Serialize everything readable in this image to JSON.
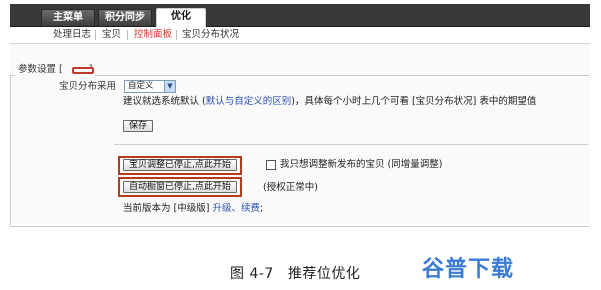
{
  "tabs": [
    {
      "label": "主菜单"
    },
    {
      "label": "积分同步"
    },
    {
      "label": "优化"
    }
  ],
  "subnav": [
    {
      "label": "处理日志"
    },
    {
      "label": "宝贝"
    },
    {
      "label": "控制面板"
    },
    {
      "label": "宝贝分布状况"
    }
  ],
  "panel": {
    "legend": "参数设置 [",
    "legend_close": "]",
    "distribution_label": "宝贝分布采用",
    "distribution_select": {
      "value": "自定义"
    },
    "hint_before": "建议就选系统默认 (",
    "hint_link": "默认与自定义的区别",
    "hint_after": ")，具体每个小时上几个可看 [宝贝分布状况] 表中的期望值",
    "save_button": "保存",
    "adjust_button": "宝贝调整已停止,点此开始",
    "checkbox_label": "我只想调整新发布的宝贝 (同增量调整)",
    "window_button": "自动橱窗已停止,点此开始",
    "auth_status": "(授权正常中)",
    "version_text": "当前版本为 [中级版]",
    "version_link": "升级、续费",
    "version_suffix": ";"
  },
  "caption": {
    "number": "图 4-7",
    "text": "推荐位优化"
  },
  "watermark": "谷普下载",
  "colors": {
    "highlight_frame": "#b33a1c",
    "link": "#2a4fb0",
    "active_subnav": "#d33a2c",
    "watermark": "#3a7bd5"
  }
}
